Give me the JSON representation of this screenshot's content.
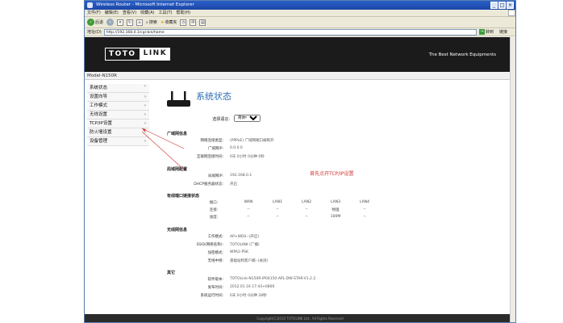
{
  "window": {
    "title": "Wireless Router - Microsoft Internet Explorer"
  },
  "menu": [
    "文件(F)",
    "编辑(E)",
    "查看(V)",
    "收藏(A)",
    "工具(T)",
    "帮助(H)"
  ],
  "toolbar": {
    "back": "后退",
    "search": "搜索",
    "favorites": "收藏夹"
  },
  "address": {
    "label": "地址(D)",
    "url": "http://192.168.0.1/cgi-bin/home",
    "go": "转到",
    "links": "链接"
  },
  "header": {
    "brand_left": "TOTO",
    "brand_right": "LINK",
    "tagline": "The Best Network Equipments"
  },
  "model": "Model-N150R",
  "sidebar": {
    "items": [
      {
        "label": "系统状态",
        "chev": "˅"
      },
      {
        "label": "设置向导",
        "chev": "›"
      },
      {
        "label": "工作模式",
        "chev": "›"
      },
      {
        "label": "无线设置",
        "chev": "›"
      },
      {
        "label": "TCP/IP设置",
        "chev": "›"
      },
      {
        "label": "防火墙设置",
        "chev": "›"
      },
      {
        "label": "设备管理",
        "chev": "›"
      }
    ]
  },
  "main": {
    "title": "系统状态",
    "lang_label": "选择语言:",
    "lang_value": "简体中文",
    "wan_section": "广域网信息",
    "wan": [
      {
        "k": "网络连接类型:",
        "v": "(PPPoE) 广域网端口被断开"
      },
      {
        "k": "广域网IP:",
        "v": "0.0.0.0"
      },
      {
        "k": "互联网连接时间:",
        "v": "0天 0小时 0分钟 0秒"
      }
    ],
    "lan_section": "局域网配置",
    "lan": [
      {
        "k": "局域网IP:",
        "v": "192.168.0.1"
      },
      {
        "k": "DHCP服务器状态:",
        "v": "开启"
      }
    ],
    "ports_section": "有线端口链接状态",
    "ports_header": [
      "端口:",
      "WAN",
      "LAN1",
      "LAN2",
      "LAN3",
      "LAN4"
    ],
    "ports_link": [
      "连接:",
      "--",
      "--",
      "--",
      "物理",
      "--"
    ],
    "ports_speed": [
      "速度:",
      "--",
      "--",
      "--",
      "100M",
      "--"
    ],
    "wireless_section": "无线网信息",
    "wireless": [
      {
        "k": "工作模式:",
        "v": "AP+WDS--(开启)"
      },
      {
        "k": "SSID(网络名称):",
        "v": "TOTOLINK (广播)"
      },
      {
        "k": "加密模式:",
        "v": "WPA2-PSK"
      },
      {
        "k": "无线中继:",
        "v": "基础站和客户端--(关闭)"
      }
    ],
    "other_section": "其它",
    "other": [
      {
        "k": "软件版本:",
        "v": "TOTOLink-N150R-IP04150-APL-DW-STAR-V1.2.2"
      },
      {
        "k": "发布时间:",
        "v": "2012.01.16 17:43+0800"
      },
      {
        "k": "系统运行时间:",
        "v": "0天 0小时 0分钟 28秒"
      }
    ],
    "note": "首先点开TCP/IP设置"
  },
  "footer": "Copyright(C)2010 TOTOLINK Ltd., All Rights Reserved"
}
